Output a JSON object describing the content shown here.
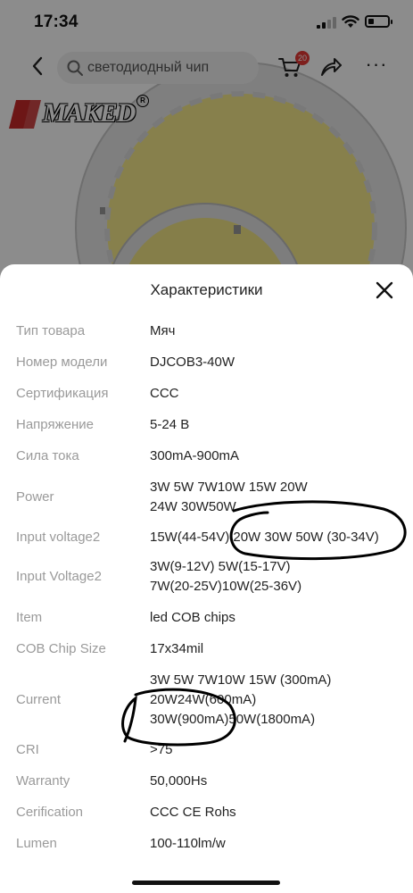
{
  "status_bar": {
    "time": "17:34"
  },
  "top_nav": {
    "search_placeholder": "светодиодный чип",
    "cart_badge": "20"
  },
  "brand": {
    "name": "MAKED",
    "reg": "R"
  },
  "sheet": {
    "title": "Характеристики",
    "specs": [
      {
        "label": "Тип товара",
        "value": [
          "Мяч"
        ]
      },
      {
        "label": "Номер модели",
        "value": [
          "DJCOB3-40W"
        ]
      },
      {
        "label": "Сертификация",
        "value": [
          "CCC"
        ]
      },
      {
        "label": "Напряжение",
        "value": [
          "5-24 В"
        ]
      },
      {
        "label": "Сила тока",
        "value": [
          "300mA-900mA"
        ]
      },
      {
        "label": "Power",
        "value": [
          "3W 5W 7W10W 15W 20W",
          "24W 30W50W"
        ]
      },
      {
        "label": "Input voltage2",
        "value": [
          "15W(44-54V) 20W 30W 50W (30-34V)"
        ]
      },
      {
        "label": "Input Voltage2",
        "value": [
          "3W(9-12V) 5W(15-17V)",
          "7W(20-25V)10W(25-36V)"
        ]
      },
      {
        "label": "Item",
        "value": [
          "led COB chips"
        ]
      },
      {
        "label": "COB Chip Size",
        "value": [
          "17x34mil"
        ]
      },
      {
        "label": "Current",
        "value": [
          "3W 5W 7W10W 15W (300mA)",
          "20W24W(600mA)",
          "30W(900mA)50W(1800mA)"
        ]
      },
      {
        "label": "CRI",
        "value": [
          ">75"
        ]
      },
      {
        "label": "Warranty",
        "value": [
          "50,000Hs"
        ]
      },
      {
        "label": "Cerification",
        "value": [
          "CCC CE Rohs"
        ]
      },
      {
        "label": "Lumen",
        "value": [
          "100-110lm/w"
        ]
      }
    ]
  },
  "icons": {
    "back": "chevron-left-icon",
    "search": "search-icon",
    "cart": "cart-icon",
    "share": "share-icon",
    "more": "more-icon",
    "close": "close-icon"
  },
  "colors": {
    "badge": "#e53935",
    "label": "#9a9a9a",
    "value": "#222222",
    "chip_yellow": "#f6ea8a"
  }
}
